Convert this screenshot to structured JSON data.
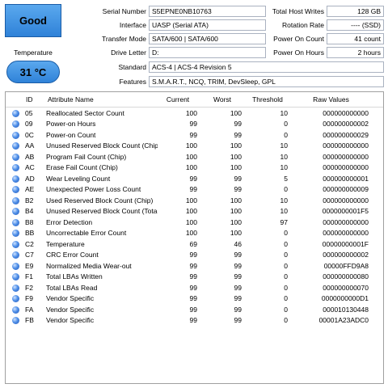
{
  "health": {
    "status": "Good",
    "temperature_label": "Temperature",
    "temperature": "31 °C",
    "color": "#3b8fe0"
  },
  "info_left": [
    {
      "label": "Serial Number",
      "value": "S5EPNE0NB10763"
    },
    {
      "label": "Interface",
      "value": "UASP (Serial ATA)"
    },
    {
      "label": "Transfer Mode",
      "value": "SATA/600 | SATA/600"
    },
    {
      "label": "Drive Letter",
      "value": "D:"
    },
    {
      "label": "Standard",
      "value": "ACS-4 | ACS-4 Revision 5"
    },
    {
      "label": "Features",
      "value": "S.M.A.R.T., NCQ, TRIM, DevSleep, GPL"
    }
  ],
  "info_right": [
    {
      "label": "Total Host Writes",
      "value": "128 GB"
    },
    {
      "label": "Rotation Rate",
      "value": "---- (SSD)"
    },
    {
      "label": "Power On Count",
      "value": "41 count"
    },
    {
      "label": "Power On Hours",
      "value": "2 hours"
    }
  ],
  "table": {
    "headers": {
      "id": "ID",
      "name": "Attribute Name",
      "current": "Current",
      "worst": "Worst",
      "threshold": "Threshold",
      "raw": "Raw Values"
    },
    "rows": [
      {
        "id": "05",
        "name": "Reallocated Sector Count",
        "current": "100",
        "worst": "100",
        "threshold": "10",
        "raw": "000000000000"
      },
      {
        "id": "09",
        "name": "Power-on Hours",
        "current": "99",
        "worst": "99",
        "threshold": "0",
        "raw": "000000000002"
      },
      {
        "id": "0C",
        "name": "Power-on Count",
        "current": "99",
        "worst": "99",
        "threshold": "0",
        "raw": "000000000029"
      },
      {
        "id": "AA",
        "name": "Unused Reserved Block Count (Chip)",
        "current": "100",
        "worst": "100",
        "threshold": "10",
        "raw": "000000000000"
      },
      {
        "id": "AB",
        "name": "Program Fail Count (Chip)",
        "current": "100",
        "worst": "100",
        "threshold": "10",
        "raw": "000000000000"
      },
      {
        "id": "AC",
        "name": "Erase Fail Count (Chip)",
        "current": "100",
        "worst": "100",
        "threshold": "10",
        "raw": "000000000000"
      },
      {
        "id": "AD",
        "name": "Wear Leveling Count",
        "current": "99",
        "worst": "99",
        "threshold": "5",
        "raw": "000000000001"
      },
      {
        "id": "AE",
        "name": "Unexpected Power Loss Count",
        "current": "99",
        "worst": "99",
        "threshold": "0",
        "raw": "000000000009"
      },
      {
        "id": "B2",
        "name": "Used Reserved Block Count (Chip)",
        "current": "100",
        "worst": "100",
        "threshold": "10",
        "raw": "000000000000"
      },
      {
        "id": "B4",
        "name": "Unused Reserved Block Count (Total)",
        "current": "100",
        "worst": "100",
        "threshold": "10",
        "raw": "0000000001F5"
      },
      {
        "id": "B8",
        "name": "Error Detection",
        "current": "100",
        "worst": "100",
        "threshold": "97",
        "raw": "000000000000"
      },
      {
        "id": "BB",
        "name": "Uncorrectable Error Count",
        "current": "100",
        "worst": "100",
        "threshold": "0",
        "raw": "000000000000"
      },
      {
        "id": "C2",
        "name": "Temperature",
        "current": "69",
        "worst": "46",
        "threshold": "0",
        "raw": "00000000001F"
      },
      {
        "id": "C7",
        "name": "CRC Error Count",
        "current": "99",
        "worst": "99",
        "threshold": "0",
        "raw": "000000000002"
      },
      {
        "id": "E9",
        "name": "Normalized Media Wear-out",
        "current": "99",
        "worst": "99",
        "threshold": "0",
        "raw": "00000FFD9A8"
      },
      {
        "id": "F1",
        "name": "Total LBAs Written",
        "current": "99",
        "worst": "99",
        "threshold": "0",
        "raw": "000000000080"
      },
      {
        "id": "F2",
        "name": "Total LBAs Read",
        "current": "99",
        "worst": "99",
        "threshold": "0",
        "raw": "000000000070"
      },
      {
        "id": "F9",
        "name": "Vendor Specific",
        "current": "99",
        "worst": "99",
        "threshold": "0",
        "raw": "0000000000D1"
      },
      {
        "id": "FA",
        "name": "Vendor Specific",
        "current": "99",
        "worst": "99",
        "threshold": "0",
        "raw": "000010130448"
      },
      {
        "id": "FB",
        "name": "Vendor Specific",
        "current": "99",
        "worst": "99",
        "threshold": "0",
        "raw": "00001A23ADC0"
      }
    ]
  }
}
